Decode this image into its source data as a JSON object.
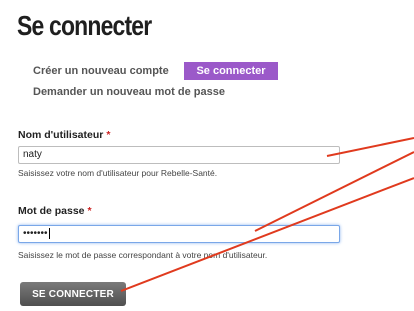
{
  "page": {
    "title": "Se connecter"
  },
  "tabs": {
    "create_account": "Créer un nouveau compte",
    "login": "Se connecter",
    "request_password": "Demander un nouveau mot de passe"
  },
  "username": {
    "label": "Nom d'utilisateur",
    "required_mark": "*",
    "value": "naty",
    "help": "Saisissez votre nom d'utilisateur pour Rebelle-Santé."
  },
  "password": {
    "label": "Mot de passe",
    "required_mark": "*",
    "value": "•••••••",
    "help": "Saisissez le mot de passe correspondant à votre nom d'utilisateur."
  },
  "form": {
    "submit_label": "SE CONNECTER"
  },
  "colors": {
    "accent": "#9b59c9",
    "annotation_arrow": "#e03a1e",
    "required": "#cc2222"
  }
}
